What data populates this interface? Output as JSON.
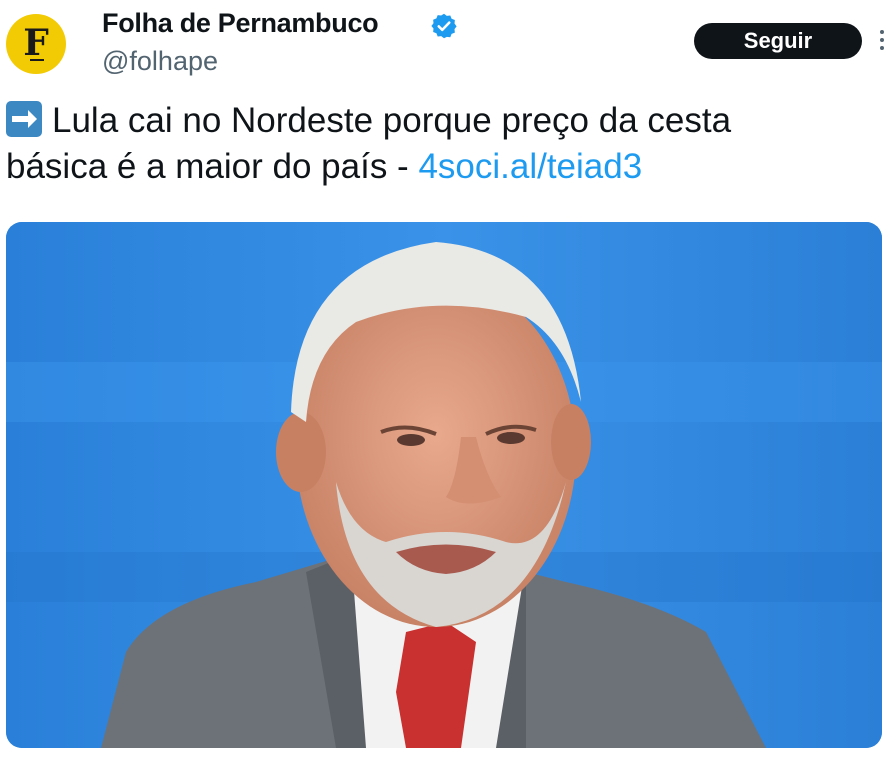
{
  "account": {
    "display_name": "Folha de Pernambuco",
    "handle": "@folhape",
    "avatar_letter": "F",
    "avatar_color": "#f2cb05",
    "verified_color": "#1d9bf0"
  },
  "follow_button": {
    "label": "Seguir"
  },
  "tweet": {
    "emoji_icon": "right-arrow-emoji-icon",
    "text_line1": "Lula cai no Nordeste porque preço da cesta",
    "text_line2": "básica é a maior do país - ",
    "link": "4soci.al/teiad3"
  },
  "media": {
    "background_color": "#2f86dc"
  }
}
